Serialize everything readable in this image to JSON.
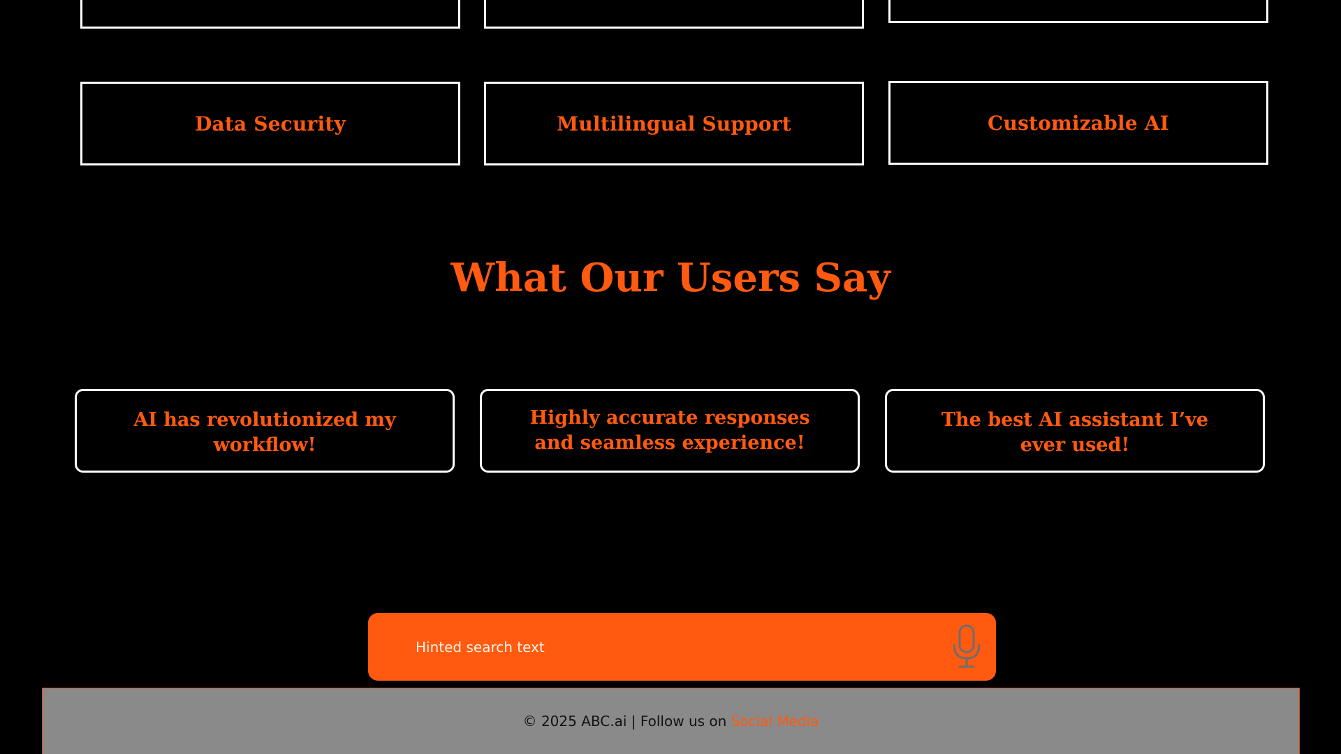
{
  "colors": {
    "background": "#000000",
    "accent": "#ff5a0f",
    "card_border": "#ffffff",
    "footer_background": "#8a8a8a"
  },
  "features": {
    "row_top": [
      "",
      "",
      ""
    ],
    "row_bottom": [
      "Data Security",
      "Multilingual Support",
      "Customizable AI"
    ]
  },
  "testimonials": {
    "heading": "What Our Users Say",
    "items": [
      "AI has revolutionized my workflow!",
      "Highly accurate responses and seamless experience!",
      "The best AI assistant I’ve ever used!"
    ]
  },
  "search": {
    "placeholder": "Hinted search text",
    "mic_icon": "microphone-icon"
  },
  "footer": {
    "text": "© 2025 ABC.ai | Follow us on ",
    "link_label": "Social Media"
  }
}
